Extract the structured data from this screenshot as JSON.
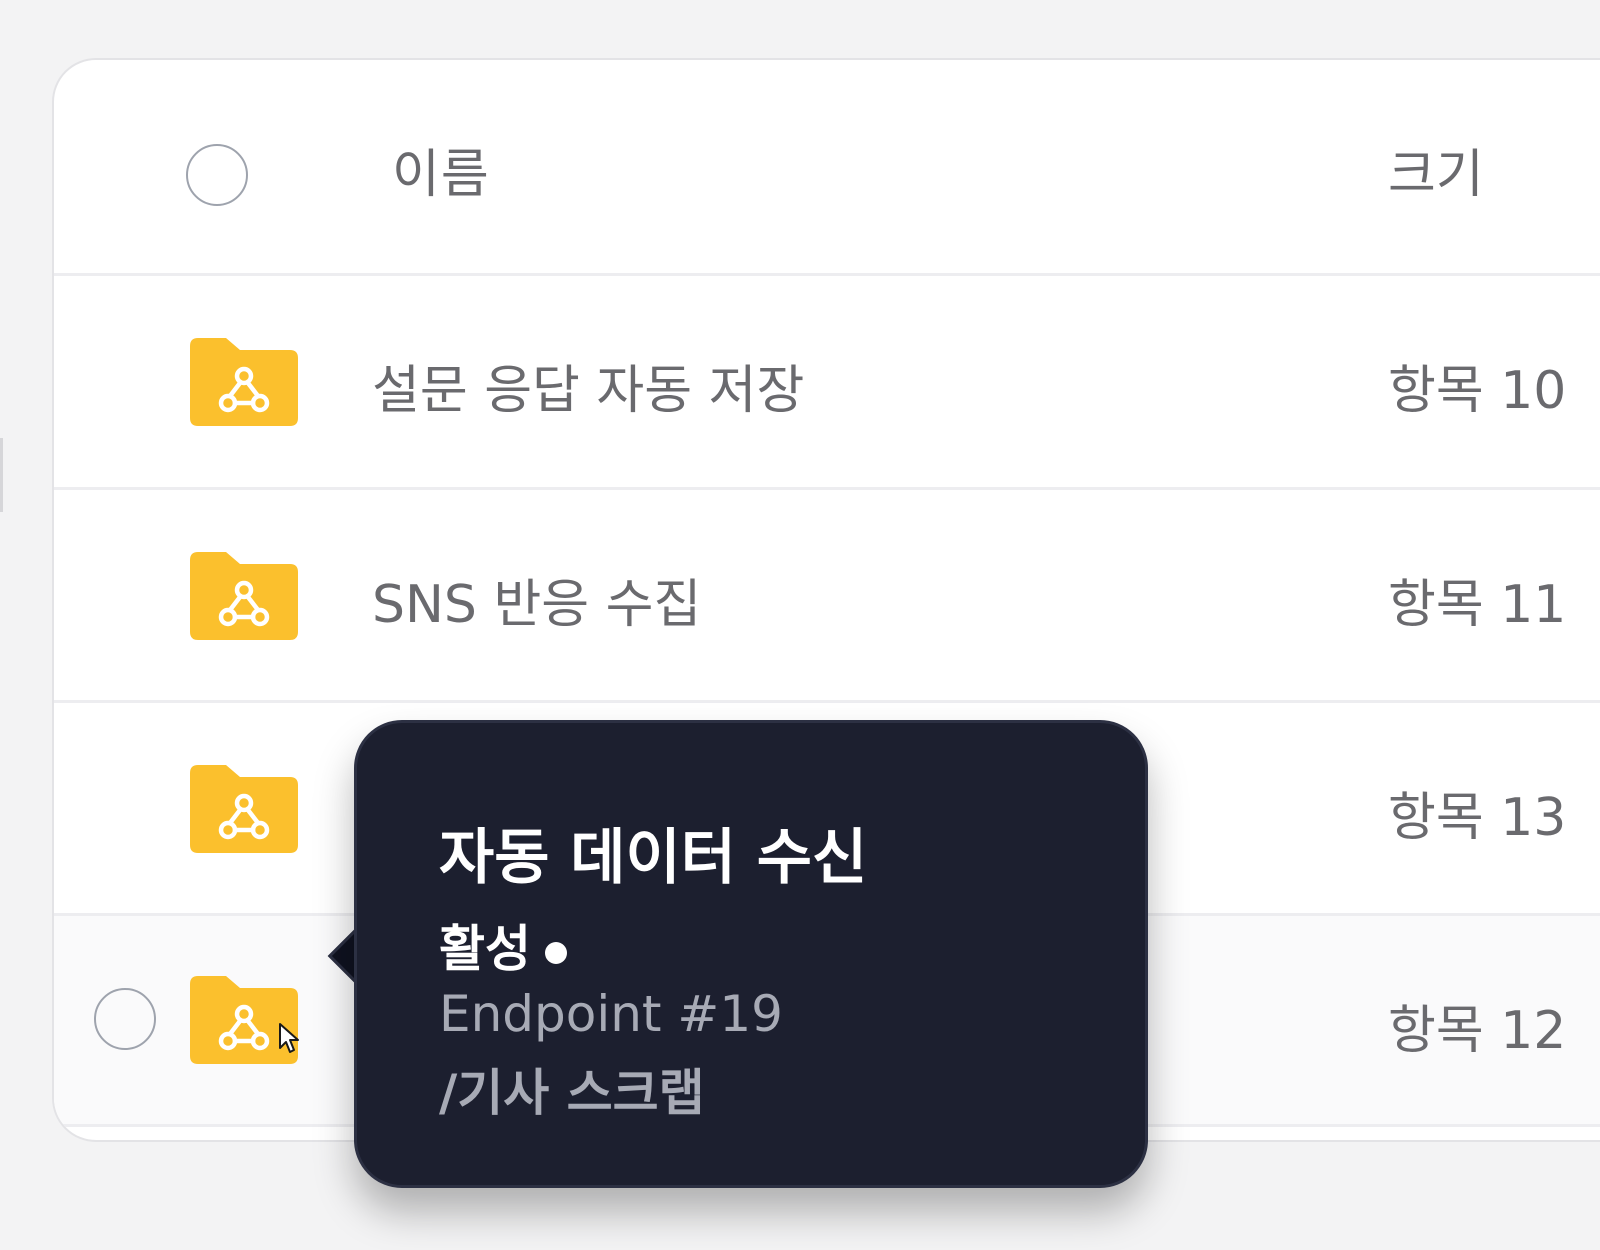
{
  "header": {
    "name_label": "이름",
    "size_label": "크기"
  },
  "rows": [
    {
      "name": "설문 응답 자동 저장",
      "size": "항목 10",
      "icon": "webhook-folder-icon"
    },
    {
      "name": "SNS 반응 수집",
      "size": "항목 11",
      "icon": "webhook-folder-icon"
    },
    {
      "name": "",
      "size": "항목 13",
      "icon": "webhook-folder-icon"
    },
    {
      "name": "",
      "size": "항목 12",
      "icon": "webhook-folder-icon"
    }
  ],
  "tooltip": {
    "title": "자동 데이터 수신",
    "status": "활성",
    "endpoint": "Endpoint #19",
    "path": "/기사 스크랩"
  },
  "colors": {
    "folder": "#fbc02d",
    "tooltip_bg": "#1c1f2f",
    "text_muted": "#6a6a6e"
  }
}
